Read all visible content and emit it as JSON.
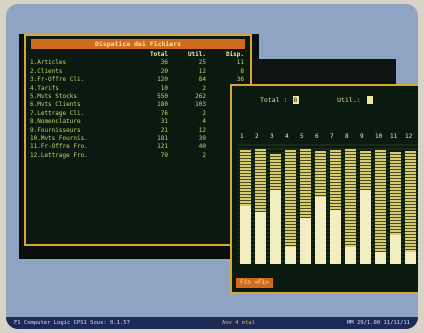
{
  "left_window": {
    "title": "Dispatica dei Fichiers",
    "headers": [
      "",
      "Total",
      "Util.",
      "Disp."
    ],
    "rows": [
      [
        "1.Articles",
        "36",
        "25",
        "11"
      ],
      [
        "2.Clients",
        "20",
        "12",
        "8"
      ],
      [
        "3.Fr-Offre Cli.",
        "120",
        "84",
        "36"
      ],
      [
        "4.Tarifs",
        "10",
        "2",
        "8"
      ],
      [
        "5.Mvts Stocks",
        "550",
        "262",
        "288"
      ],
      [
        "6.Mvts Clients",
        "180",
        "103",
        "77"
      ],
      [
        "7.Lettrage Cli.",
        "76",
        "2",
        "68"
      ],
      [
        "8.Nomenclature",
        "31",
        "4",
        "27"
      ],
      [
        "9.Fournisseurs",
        "21",
        "12",
        "9"
      ],
      [
        "10.Mvts Fournis.",
        "181",
        "39",
        "142"
      ],
      [
        "11.Fr-Offre Fro.",
        "121",
        "40",
        "81"
      ],
      [
        "12.Lettrage Fro.",
        "70",
        "2",
        "68"
      ]
    ]
  },
  "right_window": {
    "total_label": "Total :",
    "total_value": "8",
    "util_label": "Util.:",
    "util_value": "",
    "ticks": [
      "1",
      "2",
      "3",
      "4",
      "5",
      "6",
      "7",
      "8",
      "9",
      "10",
      "11",
      "12"
    ],
    "footer": "Fin <F1>",
    "chart_data": {
      "type": "bar",
      "categories": [
        "1",
        "2",
        "3",
        "4",
        "5",
        "6",
        "7",
        "8",
        "9",
        "10",
        "11",
        "12"
      ],
      "series": [
        {
          "values": [
            95,
            96,
            92,
            95,
            96,
            94,
            95,
            96,
            94,
            95,
            93,
            94
          ]
        },
        {
          "values": [
            48,
            43,
            62,
            14,
            38,
            56,
            45,
            14,
            62,
            10,
            24,
            10
          ]
        }
      ],
      "ylim": [
        0,
        100
      ]
    }
  },
  "status_bar": {
    "left": "F1 Computer Logic CPS1 Sous: 0.1.57",
    "center": "Aov 4 etal",
    "right": "MM 29/1.00 11/11/11"
  },
  "colors": {
    "accent": "#d36b1d",
    "border": "#d6a637",
    "screen": "#8fa4c2",
    "text": "#c6d36a"
  }
}
